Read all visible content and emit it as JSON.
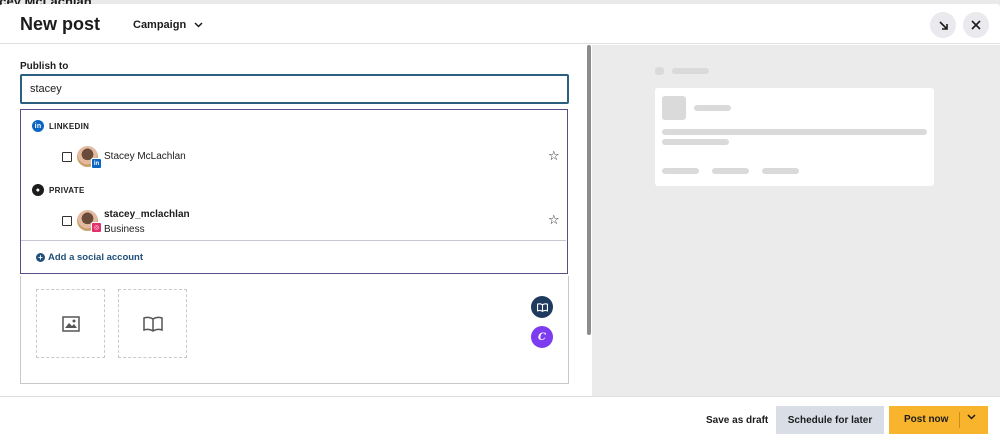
{
  "background": {
    "peek_text": "acey McLachlan"
  },
  "header": {
    "title": "New post",
    "campaign_label": "Campaign",
    "campaign_chevron": "chevron-down-icon",
    "minimize_icon": "arrow-down-right-icon",
    "close_icon": "close-icon"
  },
  "publish": {
    "label": "Publish to",
    "input_value": "stacey"
  },
  "dropdown": {
    "groups": [
      {
        "name": "LINKEDIN",
        "icon": "linkedin-icon",
        "accounts": [
          {
            "name": "Stacey McLachlan",
            "subtitle": "",
            "network_badge": "linkedin"
          }
        ]
      },
      {
        "name": "PRIVATE",
        "icon": "user-circle-icon",
        "accounts": [
          {
            "name": "stacey_mclachlan",
            "subtitle": "Business",
            "network_badge": "instagram"
          }
        ]
      }
    ],
    "add_account_label": "Add a social account"
  },
  "editor": {
    "media_slots": [
      "image-icon",
      "book-icon"
    ],
    "tools": [
      "book-icon",
      "canva-icon"
    ]
  },
  "footer": {
    "save_draft": "Save as draft",
    "schedule": "Schedule for later",
    "post_now": "Post now"
  },
  "colors": {
    "accent_border": "#2a5f80",
    "dropdown_border": "#564f8a",
    "linkedin": "#0a66c2",
    "instagram": "#e1306c",
    "post_button": "#f7b42c",
    "schedule_button": "#d8dde6",
    "canva": "#7d3cf0",
    "book_tool": "#1f3a5f"
  }
}
